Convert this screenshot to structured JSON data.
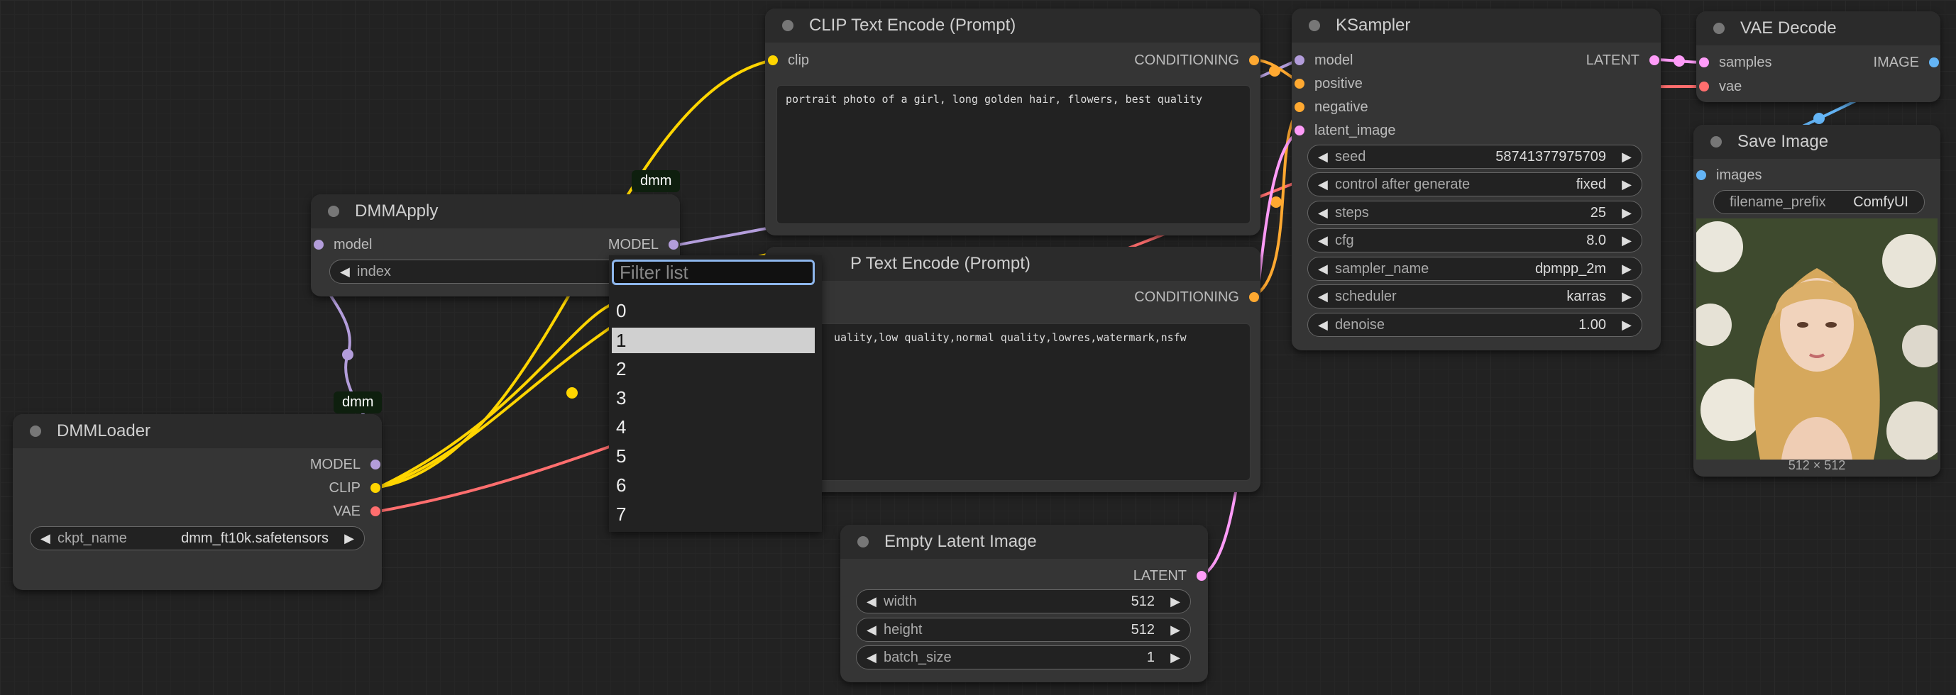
{
  "nodes": {
    "dmmloader": {
      "title": "DMMLoader",
      "outputs": [
        "MODEL",
        "CLIP",
        "VAE"
      ],
      "ckpt_name": {
        "label": "ckpt_name",
        "value": "dmm_ft10k.safetensors"
      }
    },
    "dmmapply": {
      "title": "DMMApply",
      "input": "model",
      "output": "MODEL",
      "index": {
        "label": "index"
      }
    },
    "clip_pos": {
      "title": "CLIP Text Encode (Prompt)",
      "input": "clip",
      "output": "CONDITIONING",
      "text": "portrait photo of a girl, long golden hair, flowers, best quality"
    },
    "clip_neg": {
      "title": "CLIP Text Encode (Prompt)",
      "title_visible": "P Text Encode (Prompt)",
      "output": "CONDITIONING",
      "text": "uality,low quality,normal quality,lowres,watermark,nsfw"
    },
    "ksampler": {
      "title": "KSampler",
      "inputs": [
        "model",
        "positive",
        "negative",
        "latent_image"
      ],
      "output": "LATENT",
      "widgets": [
        {
          "label": "seed",
          "value": "58741377975709"
        },
        {
          "label": "control after generate",
          "value": "fixed"
        },
        {
          "label": "steps",
          "value": "25"
        },
        {
          "label": "cfg",
          "value": "8.0"
        },
        {
          "label": "sampler_name",
          "value": "dpmpp_2m"
        },
        {
          "label": "scheduler",
          "value": "karras"
        },
        {
          "label": "denoise",
          "value": "1.00"
        }
      ]
    },
    "vae_decode": {
      "title": "VAE Decode",
      "inputs": [
        "samples",
        "vae"
      ],
      "output": "IMAGE"
    },
    "save_image": {
      "title": "Save Image",
      "input": "images",
      "filename_prefix": {
        "label": "filename_prefix",
        "value": "ComfyUI"
      },
      "preview_size": "512 × 512"
    },
    "empty_latent": {
      "title": "Empty Latent Image",
      "output": "LATENT",
      "widgets": [
        {
          "label": "width",
          "value": "512"
        },
        {
          "label": "height",
          "value": "512"
        },
        {
          "label": "batch_size",
          "value": "1"
        }
      ]
    }
  },
  "badges": {
    "top": "dmm",
    "left": "dmm"
  },
  "dropdown": {
    "placeholder": "Filter list",
    "options": [
      "0",
      "1",
      "2",
      "3",
      "4",
      "5",
      "6",
      "7"
    ],
    "selected": "1"
  },
  "colors": {
    "clip": "#ffd500",
    "model": "#b39ddb",
    "vae": "#ff6e6e",
    "latent": "#ff9cf9",
    "conditioning": "#ffa931",
    "image": "#64b5f6"
  },
  "arrow_left": "◀",
  "arrow_right": "▶"
}
